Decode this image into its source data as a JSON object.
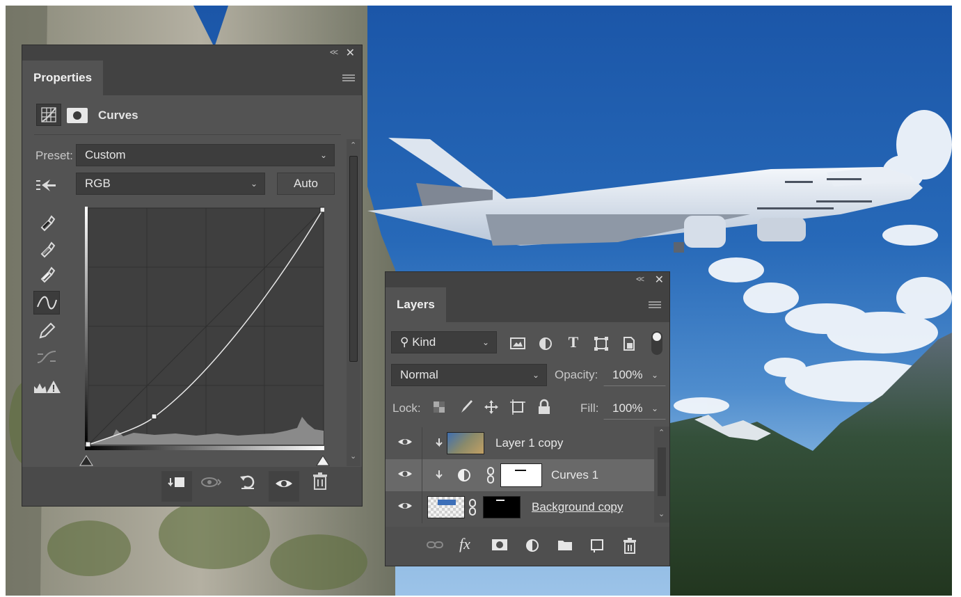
{
  "properties_panel": {
    "tab": "Properties",
    "adjustment_title": "Curves",
    "preset_label": "Preset:",
    "preset_value": "Custom",
    "channel_value": "RGB",
    "auto_label": "Auto",
    "tools": [
      "sample-shadows-icon",
      "sample-gray-icon",
      "sample-highlights-icon",
      "curve-points-icon",
      "pencil-icon",
      "smooth-curve-icon",
      "clipping-warning-icon"
    ],
    "bottom_buttons": [
      "clip-to-layer-icon",
      "view-previous-icon",
      "reset-icon",
      "visibility-icon",
      "delete-icon"
    ]
  },
  "layers_panel": {
    "tab": "Layers",
    "filter_value": "Kind",
    "blend_mode": "Normal",
    "opacity_label": "Opacity:",
    "opacity_value": "100%",
    "lock_label": "Lock:",
    "fill_label": "Fill:",
    "fill_value": "100%",
    "layers": [
      {
        "name": "Layer 1 copy",
        "clipped": true,
        "selected": false
      },
      {
        "name": "Curves 1",
        "clipped": true,
        "selected": true
      },
      {
        "name": "Background copy",
        "clipped": false,
        "selected": false
      }
    ],
    "bottom_buttons": [
      "link-icon",
      "fx-icon",
      "mask-icon",
      "adjustment-icon",
      "folder-icon",
      "new-layer-icon",
      "delete-icon"
    ]
  },
  "colors": {
    "panel": "#535353",
    "panel_dark": "#424242",
    "selected_row": "#696969"
  }
}
